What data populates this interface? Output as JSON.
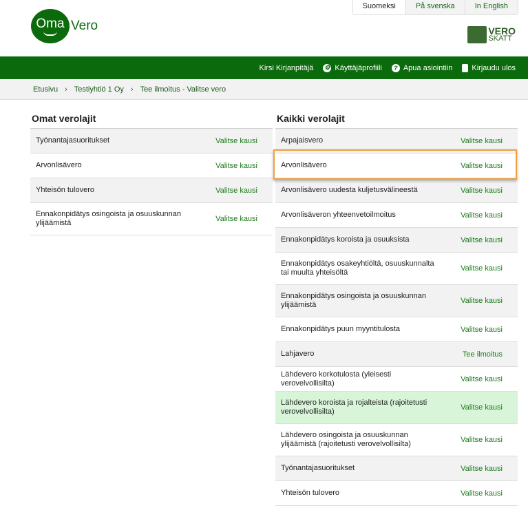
{
  "languages": [
    "Suomeksi",
    "På svenska",
    "In English"
  ],
  "logo": {
    "oma": "Oma",
    "vero": "Vero",
    "brand_top": "VERO",
    "brand_bottom": "SKATT"
  },
  "nav": {
    "user": "Kirsi Kirjanpitäjä",
    "profile": "Käyttäjäprofiili",
    "help": "Apua asiointiin",
    "logout": "Kirjaudu ulos"
  },
  "breadcrumb": [
    "Etusivu",
    "Testiyhtiö 1 Oy",
    "Tee ilmoitus - Valitse vero"
  ],
  "own": {
    "title": "Omat verolajit",
    "items": [
      {
        "name": "Työnantajasuoritukset",
        "action": "Valitse kausi"
      },
      {
        "name": "Arvonlisävero",
        "action": "Valitse kausi"
      },
      {
        "name": "Yhteisön tulovero",
        "action": "Valitse kausi"
      },
      {
        "name": "Ennakonpidätys osingoista ja osuuskunnan ylijäämistä",
        "action": "Valitse kausi"
      }
    ]
  },
  "all": {
    "title": "Kaikki verolajit",
    "items": [
      {
        "name": "Arpajaisvero",
        "action": "Valitse kausi"
      },
      {
        "name": "Arvonlisävero",
        "action": "Valitse kausi"
      },
      {
        "name": "Arvonlisävero uudesta kuljetusvälineestä",
        "action": "Valitse kausi"
      },
      {
        "name": "Arvonlisäveron yhteenvetoilmoitus",
        "action": "Valitse kausi"
      },
      {
        "name": "Ennakonpidätys koroista ja osuuksista",
        "action": "Valitse kausi"
      },
      {
        "name": "Ennakonpidätys osakeyhtiöltä, osuuskunnalta tai muulta yhteisöltä",
        "action": "Valitse kausi"
      },
      {
        "name": "Ennakonpidätys osingoista ja osuuskunnan ylijäämistä",
        "action": "Valitse kausi"
      },
      {
        "name": "Ennakonpidätys puun myyntitulosta",
        "action": "Valitse kausi"
      },
      {
        "name": "Lahjavero",
        "action": "Tee ilmoitus"
      },
      {
        "name": "Lähdevero korkotulosta (yleisesti verovelvollisilta)",
        "action": "Valitse kausi"
      },
      {
        "name": "Lähdevero koroista ja rojalteista (rajoitetusti verovelvollisilta)",
        "action": "Valitse kausi"
      },
      {
        "name": "Lähdevero osingoista ja osuuskunnan ylijäämistä (rajoitetusti verovelvollisilta)",
        "action": "Valitse kausi"
      },
      {
        "name": "Työnantajasuoritukset",
        "action": "Valitse kausi"
      },
      {
        "name": "Yhteisön tulovero",
        "action": "Valitse kausi"
      }
    ]
  },
  "highlight_color": "#d9f5d9",
  "brand_color": "#0b6a0b"
}
